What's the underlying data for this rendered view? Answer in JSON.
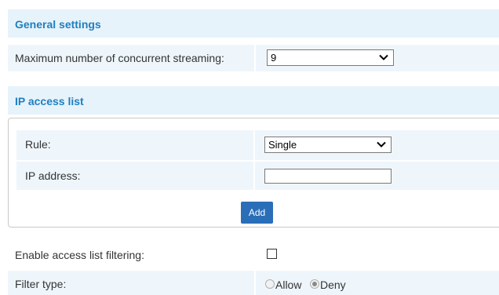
{
  "general_settings": {
    "title": "General settings",
    "max_streaming": {
      "label": "Maximum number of concurrent streaming:",
      "value": "9"
    }
  },
  "ip_access_list": {
    "title": "IP access list",
    "rule": {
      "label": "Rule:",
      "value": "Single"
    },
    "ip_address": {
      "label": "IP address:",
      "value": ""
    },
    "add_label": "Add"
  },
  "enable_filtering": {
    "label": "Enable access list filtering:",
    "checked": false
  },
  "filter_type": {
    "label": "Filter type:",
    "options": [
      "Allow",
      "Deny"
    ],
    "selected": "Deny"
  },
  "colors": {
    "header_bg": "#e6f3fb",
    "header_text": "#1f7fc0",
    "row_alt_bg": "#eef6fc",
    "button_bg": "#2a6eb8"
  }
}
